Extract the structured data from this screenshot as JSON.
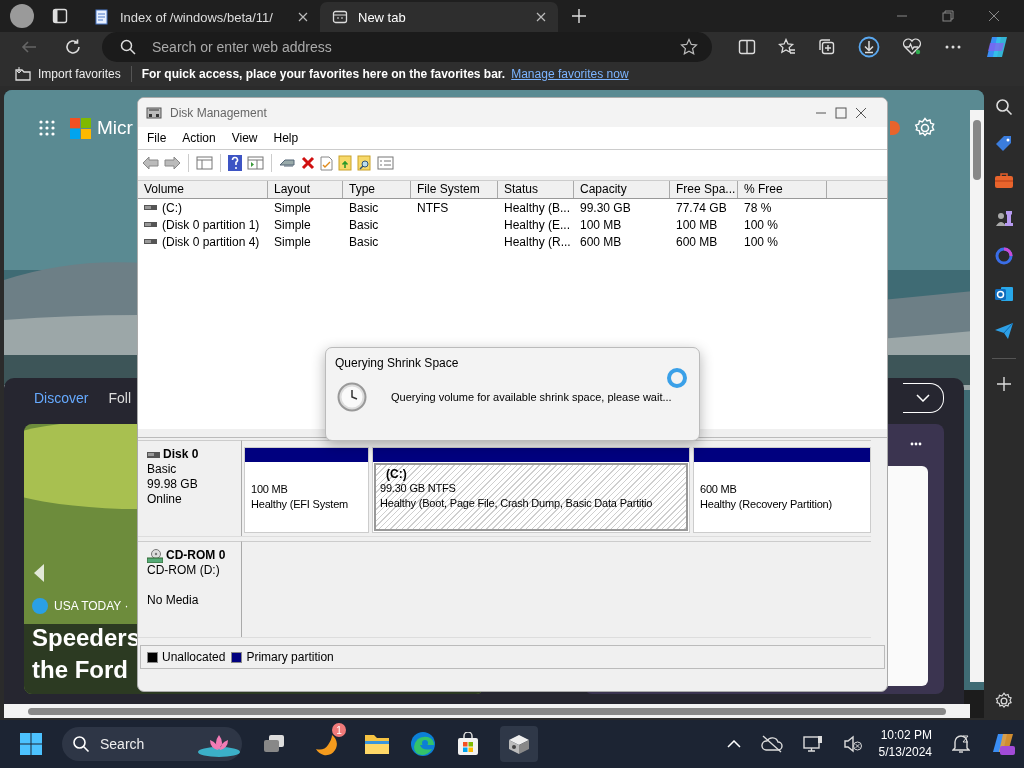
{
  "browser": {
    "tabs": [
      {
        "title": "Index of /windows/beta/11/",
        "selected": false
      },
      {
        "title": "New tab",
        "selected": true
      }
    ],
    "address": {
      "placeholder": "Search or enter web address"
    },
    "favorites_bar": {
      "import": "Import favorites",
      "hint": "For quick access, place your favorites here on the favorites bar.",
      "link": "Manage favorites now"
    }
  },
  "new_tab": {
    "logo_text": "Micr",
    "feed_tabs": [
      {
        "label": "Discover",
        "selected": true
      },
      {
        "label": "Foll",
        "selected": false
      }
    ],
    "card": {
      "source": "USA TODAY ·",
      "headline": [
        "Speeders",
        "the Ford"
      ]
    }
  },
  "disk_management": {
    "title": "Disk Management",
    "menu": [
      "File",
      "Action",
      "View",
      "Help"
    ],
    "columns": [
      "Volume",
      "Layout",
      "Type",
      "File System",
      "Status",
      "Capacity",
      "Free Spa...",
      "% Free"
    ],
    "rows": [
      [
        "(C:)",
        "Simple",
        "Basic",
        "NTFS",
        "Healthy (B...",
        "99.30 GB",
        "77.74 GB",
        "78 %"
      ],
      [
        "(Disk 0 partition 1)",
        "Simple",
        "Basic",
        "",
        "Healthy (E...",
        "100 MB",
        "100 MB",
        "100 %"
      ],
      [
        "(Disk 0 partition 4)",
        "Simple",
        "Basic",
        "",
        "Healthy (R...",
        "600 MB",
        "600 MB",
        "100 %"
      ]
    ],
    "disks": [
      {
        "kind": "disk",
        "name": "Disk 0",
        "lines": [
          "Basic",
          "99.98 GB",
          "Online"
        ],
        "partitions": [
          {
            "size": "100 MB",
            "status": "Healthy (EFI System",
            "selected": false
          },
          {
            "label": "(C:)",
            "size": "99.30 GB NTFS",
            "status": "Healthy (Boot, Page File, Crash Dump, Basic Data Partitio",
            "selected": true
          },
          {
            "size": "600 MB",
            "status": "Healthy (Recovery Partition)",
            "selected": false
          }
        ]
      },
      {
        "kind": "cdrom",
        "name": "CD-ROM 0",
        "lines": [
          "CD-ROM (D:)",
          "No Media"
        ]
      }
    ],
    "legend": [
      {
        "label": "Unallocated",
        "color": "#000000"
      },
      {
        "label": "Primary partition",
        "color": "#00007f"
      }
    ]
  },
  "dialog": {
    "title": "Querying Shrink Space",
    "message": "Querying volume for available shrink space, please wait..."
  },
  "taskbar": {
    "search": "Search",
    "badge": "1",
    "time": "10:02 PM",
    "date": "5/13/2024"
  }
}
